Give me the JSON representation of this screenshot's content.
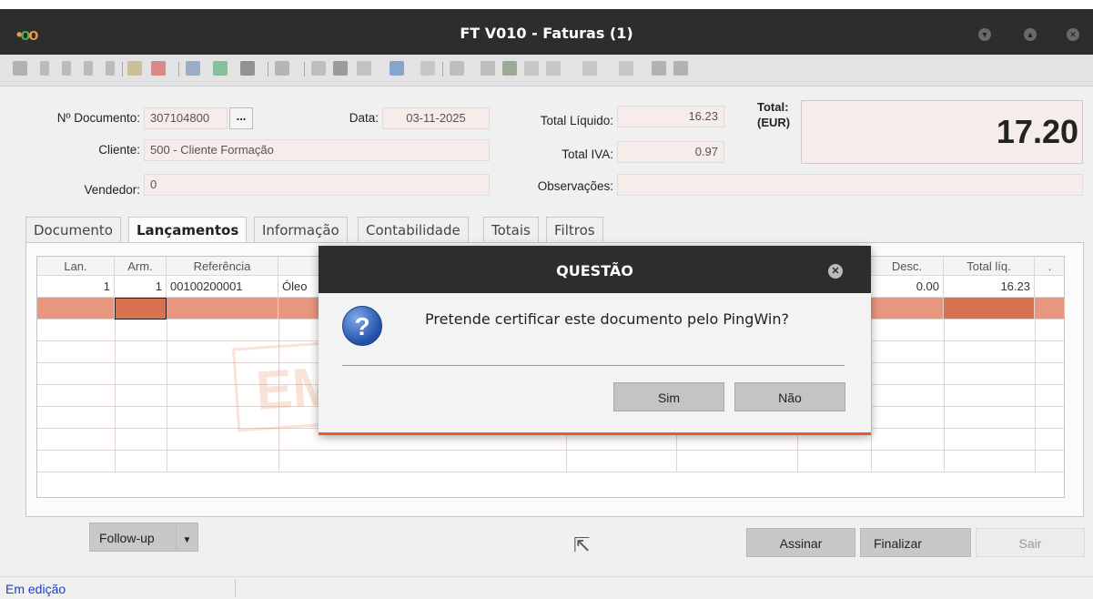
{
  "window": {
    "title": "FT V010 - Faturas (1)"
  },
  "header": {
    "doc_label": "Nº Documento:",
    "doc_value": "307104800",
    "doc_lookup": "...",
    "date_label": "Data:",
    "date_value": "03-11-2025",
    "client_label": "Cliente:",
    "client_value": "500 - Cliente Formação",
    "seller_label": "Vendedor:",
    "seller_value": "0",
    "net_label": "Total Líquido:",
    "net_value": "16.23",
    "vat_label": "Total IVA:",
    "vat_value": "0.97",
    "obs_label": "Observações:",
    "obs_value": "",
    "total_label_1": "Total:",
    "total_label_2": "(EUR)",
    "total_value": "17.20"
  },
  "tabs": [
    {
      "label": "Documento"
    },
    {
      "label": "Lançamentos",
      "active": true
    },
    {
      "label": "Informação"
    },
    {
      "label": "Contabilidade"
    },
    {
      "label": "Totais"
    },
    {
      "label": "Filtros"
    }
  ],
  "grid": {
    "headers": {
      "lan": "Lan.",
      "arm": "Arm.",
      "ref": "Referência",
      "desc": "Desc.",
      "total": "Total líq.",
      "extra": "."
    },
    "row1": {
      "lan": "1",
      "arm": "1",
      "ref": "00100200001",
      "description": "Óleo",
      "desc": "0.00",
      "total": "16.23"
    },
    "watermark": "EM"
  },
  "buttons": {
    "followup": "Follow-up",
    "sign": "Assinar",
    "finish": "Finalizar",
    "exit": "Sair"
  },
  "status": {
    "text": "Em edição"
  },
  "dialog": {
    "title": "QUESTÃO",
    "message": "Pretende certificar este documento pelo PingWin?",
    "yes": "Sim",
    "no": "Não",
    "icon": "question-icon"
  },
  "colors": {
    "titlebar": "#2d2d2d",
    "field_bg": "#f6ecea",
    "selected_row": "#e8967e",
    "dialog_accent": "#e85a28",
    "status_text": "#1a3dcc"
  }
}
